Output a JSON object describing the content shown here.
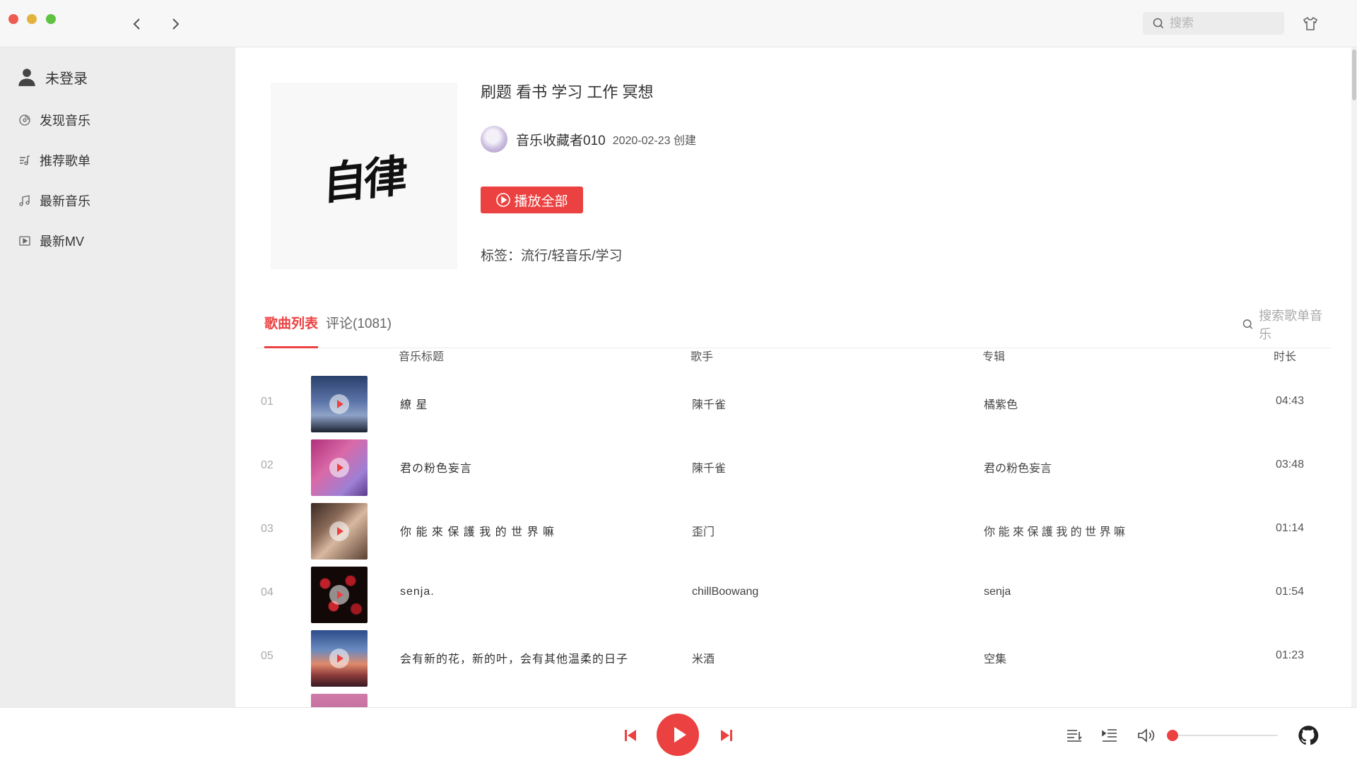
{
  "search": {
    "placeholder": "搜索"
  },
  "sidebar": {
    "user": "未登录",
    "items": [
      {
        "label": "发现音乐",
        "icon": "disc-icon"
      },
      {
        "label": "推荐歌单",
        "icon": "playlist-icon"
      },
      {
        "label": "最新音乐",
        "icon": "music-note-icon"
      },
      {
        "label": "最新MV",
        "icon": "video-icon"
      }
    ]
  },
  "playlist": {
    "cover_text": "自律",
    "title": "刷题 看书 学习 工作 冥想",
    "creator": "音乐收藏者010",
    "created": "2020-02-23 创建",
    "play_all": "播放全部",
    "tags": "标签：流行/轻音乐/学习"
  },
  "tabs": {
    "songs": "歌曲列表",
    "comments": "评论(1081)",
    "search_placeholder": "搜索歌单音乐"
  },
  "columns": {
    "title": "音乐标题",
    "artist": "歌手",
    "album": "专辑",
    "duration": "时长"
  },
  "songs": [
    {
      "idx": "01",
      "title": "繚 星",
      "artist": "陳千雀",
      "album": "橘紫色",
      "duration": "04:43"
    },
    {
      "idx": "02",
      "title": "君の粉色妄言",
      "artist": "陳千雀",
      "album": "君の粉色妄言",
      "duration": "03:48"
    },
    {
      "idx": "03",
      "title": "你 能 來 保 護 我 的 世 界 嘛",
      "artist": "歪门",
      "album": "你 能 來 保 護 我 的 世 界 嘛",
      "duration": "01:14"
    },
    {
      "idx": "04",
      "title": "senja.",
      "artist": "chillBoowang",
      "album": "senja",
      "duration": "01:54"
    },
    {
      "idx": "05",
      "title": "会有新的花，新的叶，会有其他温柔的日子",
      "artist": "米酒",
      "album": "空集",
      "duration": "01:23"
    }
  ],
  "player": {
    "volume": 0.03
  },
  "colors": {
    "accent": "#ec4141",
    "sidebar_bg": "#ededed"
  }
}
